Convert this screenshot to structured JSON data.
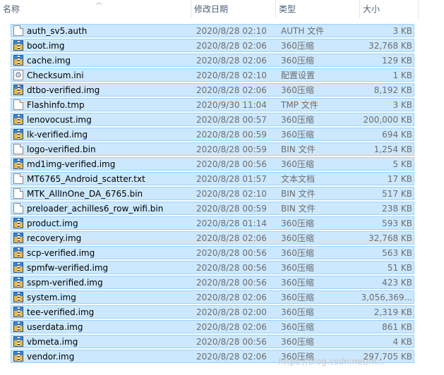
{
  "columns": {
    "name": "名称",
    "date": "修改日期",
    "type": "类型",
    "size": "大小"
  },
  "files": [
    {
      "name": "auth_sv5.auth",
      "date": "2020/8/28 02:10",
      "type": "AUTH 文件",
      "size": "3 KB",
      "icon": "file-icon"
    },
    {
      "name": "boot.img",
      "date": "2020/8/28 02:06",
      "type": "360压缩",
      "size": "32,768 KB",
      "icon": "archive-icon"
    },
    {
      "name": "cache.img",
      "date": "2020/8/28 02:06",
      "type": "360压缩",
      "size": "129 KB",
      "icon": "archive-icon"
    },
    {
      "name": "Checksum.ini",
      "date": "2020/8/28 02:10",
      "type": "配置设置",
      "size": "1 KB",
      "icon": "config-icon"
    },
    {
      "name": "dtbo-verified.img",
      "date": "2020/8/28 02:06",
      "type": "360压缩",
      "size": "8,192 KB",
      "icon": "archive-icon"
    },
    {
      "name": "Flashinfo.tmp",
      "date": "2020/9/30 11:04",
      "type": "TMP 文件",
      "size": "3 KB",
      "icon": "file-icon"
    },
    {
      "name": "lenovocust.img",
      "date": "2020/8/28 00:57",
      "type": "360压缩",
      "size": "200,000 KB",
      "icon": "archive-icon"
    },
    {
      "name": "lk-verified.img",
      "date": "2020/8/28 00:59",
      "type": "360压缩",
      "size": "694 KB",
      "icon": "archive-icon"
    },
    {
      "name": "logo-verified.bin",
      "date": "2020/8/28 00:59",
      "type": "BIN 文件",
      "size": "1,254 KB",
      "icon": "file-icon"
    },
    {
      "name": "md1img-verified.img",
      "date": "2020/8/28 00:56",
      "type": "360压缩",
      "size": "5 KB",
      "icon": "archive-icon"
    },
    {
      "name": "MT6765_Android_scatter.txt",
      "date": "2020/8/28 01:57",
      "type": "文本文档",
      "size": "17 KB",
      "icon": "file-icon"
    },
    {
      "name": "MTK_AllInOne_DA_6765.bin",
      "date": "2020/8/28 02:10",
      "type": "BIN 文件",
      "size": "517 KB",
      "icon": "file-icon"
    },
    {
      "name": "preloader_achilles6_row_wifi.bin",
      "date": "2020/8/28 00:59",
      "type": "BIN 文件",
      "size": "238 KB",
      "icon": "file-icon"
    },
    {
      "name": "product.img",
      "date": "2020/8/28 01:14",
      "type": "360压缩",
      "size": "593 KB",
      "icon": "archive-icon"
    },
    {
      "name": "recovery.img",
      "date": "2020/8/28 02:06",
      "type": "360压缩",
      "size": "32,768 KB",
      "icon": "archive-icon"
    },
    {
      "name": "scp-verified.img",
      "date": "2020/8/28 00:56",
      "type": "360压缩",
      "size": "563 KB",
      "icon": "archive-icon"
    },
    {
      "name": "spmfw-verified.img",
      "date": "2020/8/28 00:56",
      "type": "360压缩",
      "size": "51 KB",
      "icon": "archive-icon"
    },
    {
      "name": "sspm-verified.img",
      "date": "2020/8/28 00:56",
      "type": "360压缩",
      "size": "423 KB",
      "icon": "archive-icon"
    },
    {
      "name": "system.img",
      "date": "2020/8/28 02:06",
      "type": "360压缩",
      "size": "3,056,369...",
      "icon": "archive-icon"
    },
    {
      "name": "tee-verified.img",
      "date": "2020/8/28 02:00",
      "type": "360压缩",
      "size": "2,319 KB",
      "icon": "archive-icon"
    },
    {
      "name": "userdata.img",
      "date": "2020/8/28 02:06",
      "type": "360压缩",
      "size": "861 KB",
      "icon": "archive-icon"
    },
    {
      "name": "vbmeta.img",
      "date": "2020/8/28 00:56",
      "type": "360压缩",
      "size": "4 KB",
      "icon": "archive-icon"
    },
    {
      "name": "vendor.img",
      "date": "2020/8/28 02:06",
      "type": "360压缩",
      "size": "297,705 KB",
      "icon": "archive-icon"
    }
  ],
  "watermark": "https://blog.csdn.net/m..."
}
